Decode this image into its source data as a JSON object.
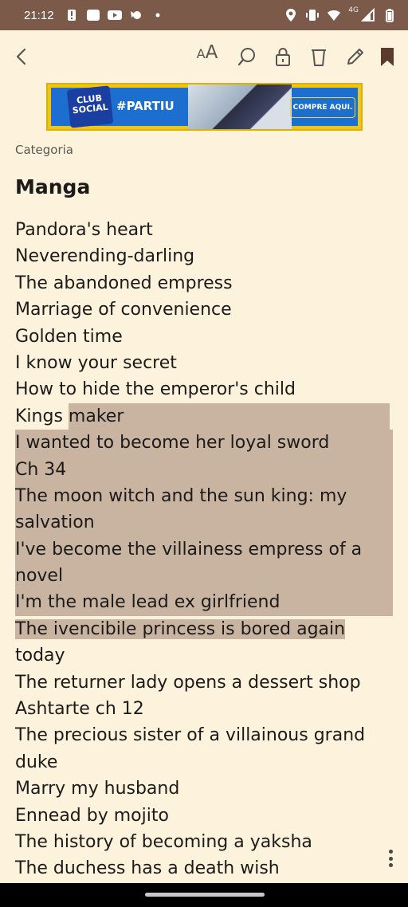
{
  "status": {
    "time": "21:12",
    "network": "4G",
    "icons": [
      "alert-icon",
      "app-icon",
      "youtube-icon",
      "bird-icon",
      "dot-icon",
      "location-icon",
      "vibrate-icon",
      "wifi-icon",
      "signal-icon",
      "battery-icon"
    ]
  },
  "toolbar": {
    "back": "back-icon",
    "text_size": {
      "small": "A",
      "big": "A"
    },
    "actions": [
      "search-icon",
      "lock-icon",
      "trash-icon",
      "edit-icon",
      "bookmark-icon"
    ]
  },
  "ad": {
    "logo": "CLUB SOCIAL",
    "tag": "#PARTIU",
    "cta": "COMPRE AQUI."
  },
  "category_label": "Categoria",
  "title": "Manga",
  "lines": [
    "Pandora's heart",
    "Neverending-darling",
    "The abandoned empress",
    "Marriage of convenience",
    "Golden time",
    "I know your secret",
    "How to hide the emperor's child",
    "Kings maker",
    "I wanted to become her loyal sword",
    "Ch 34",
    "The moon witch and the sun king: my",
    "salvation",
    "I've become the villainess empress of a",
    "novel",
    "I'm the male lead ex girlfriend",
    "The ivencibile princess is bored again",
    "today",
    "The returner lady opens a dessert shop",
    "Ashtarte ch 12",
    "The precious sister of a villainous grand",
    "duke",
    "Marry my husband",
    "Ennead by mojito",
    "The history of becoming a yaksha",
    "The duchess has a death wish"
  ],
  "split_line": {
    "plain": "Kings ",
    "highlighted": "maker"
  },
  "colors": {
    "background": "#fdf3dc",
    "status_bar": "#7b5a4a",
    "highlight": "#c9b4a1"
  }
}
